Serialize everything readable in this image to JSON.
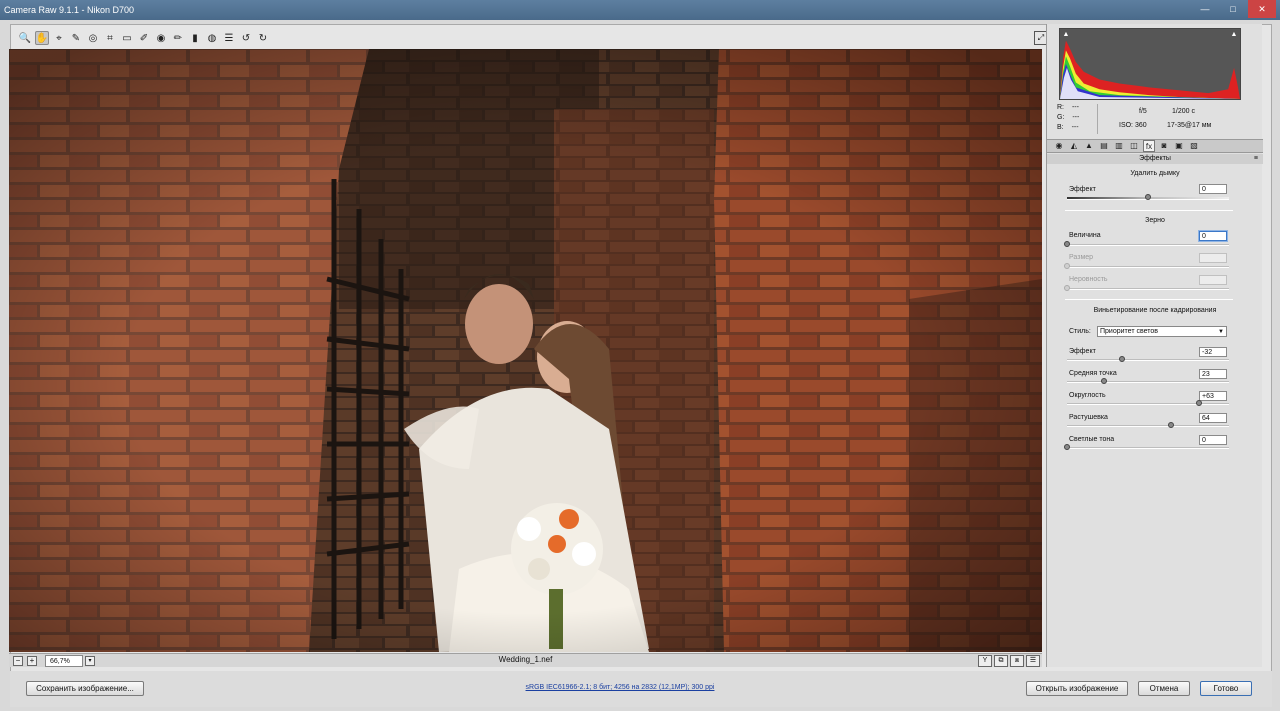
{
  "window": {
    "title": "Camera Raw 9.1.1  -  Nikon D700",
    "min_glyph": "—",
    "max_glyph": "□",
    "close_glyph": "✕"
  },
  "toolbar": {
    "tools": [
      {
        "name": "zoom-tool-icon",
        "glyph": "🔍"
      },
      {
        "name": "hand-tool-icon",
        "glyph": "✋"
      },
      {
        "name": "white-balance-tool-icon",
        "glyph": "⌖"
      },
      {
        "name": "color-sampler-tool-icon",
        "glyph": "✎"
      },
      {
        "name": "targeted-adjustment-tool-icon",
        "glyph": "◎"
      },
      {
        "name": "crop-tool-icon",
        "glyph": "⌗"
      },
      {
        "name": "straighten-tool-icon",
        "glyph": "▭"
      },
      {
        "name": "spot-removal-tool-icon",
        "glyph": "✐"
      },
      {
        "name": "red-eye-tool-icon",
        "glyph": "◉"
      },
      {
        "name": "adjustment-brush-icon",
        "glyph": "✏"
      },
      {
        "name": "graduated-filter-icon",
        "glyph": "▮"
      },
      {
        "name": "radial-filter-icon",
        "glyph": "◍"
      },
      {
        "name": "preferences-icon",
        "glyph": "☰"
      },
      {
        "name": "rotate-left-icon",
        "glyph": "↺"
      },
      {
        "name": "rotate-right-icon",
        "glyph": "↻"
      }
    ],
    "fullscreen_glyph": "⤢"
  },
  "image_status": {
    "zoom_out_glyph": "−",
    "zoom_in_glyph": "+",
    "zoom_value": "66,7%",
    "zoom_dropdown_glyph": "▾",
    "filename": "Wedding_1.nef",
    "view_glyphs": [
      "Y",
      "⧉",
      "⧈",
      "☰"
    ]
  },
  "panel": {
    "rgb": {
      "r_label": "R:",
      "g_label": "G:",
      "b_label": "B:",
      "r": "---",
      "g": "---",
      "b": "---"
    },
    "exif": {
      "aperture": "f/5",
      "shutter": "1/200 с",
      "iso": "ISO: 360",
      "lens": "17-35@17 мм"
    },
    "tabs": [
      "◉",
      "◭",
      "▲",
      "▤",
      "▥",
      "◫",
      "fx",
      "◙",
      "▣",
      "▧"
    ],
    "title": "Эффекты",
    "menu_glyph": "≡",
    "dehaze": {
      "section": "Удалить дымку",
      "label": "Эффект",
      "value": "0",
      "level": 0.5
    },
    "grain": {
      "section": "Зерно",
      "amount_label": "Величина",
      "amount_value": "0",
      "size_label": "Размер",
      "roughness_label": "Неровность"
    },
    "vignette": {
      "section": "Виньетирование после кадрирования",
      "style_label": "Стиль:",
      "style_value": "Приоритет светов",
      "rows": [
        {
          "label": "Эффект",
          "value": "-32",
          "level": 0.34
        },
        {
          "label": "Средняя точка",
          "value": "23",
          "level": 0.23
        },
        {
          "label": "Округлость",
          "value": "+63",
          "level": 0.815
        },
        {
          "label": "Растушевка",
          "value": "64",
          "level": 0.64
        },
        {
          "label": "Светлые тона",
          "value": "0",
          "level": 0.0
        }
      ]
    }
  },
  "bottom": {
    "save_label": "Сохранить изображение...",
    "workflow_text": "sRGB IEC61966-2.1; 8 бит; 4256 на 2832 (12,1МР); 300 ppi",
    "open_label": "Открыть изображение",
    "cancel_label": "Отмена",
    "done_label": "Готово"
  }
}
